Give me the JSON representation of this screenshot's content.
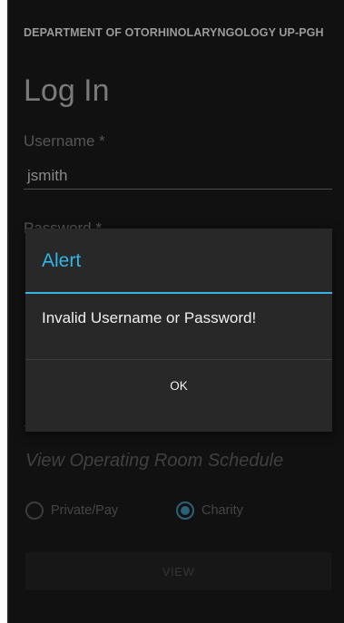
{
  "header": {
    "department": "DEPARTMENT OF OTORHINOLARYNGOLOGY UP-PGH",
    "title": "Log In"
  },
  "form": {
    "username_label": "Username *",
    "username_value": "jsmith",
    "password_label": "Password *"
  },
  "schedule": {
    "heading": "View Operating Room Schedule",
    "options": [
      {
        "label": "Private/Pay",
        "selected": false
      },
      {
        "label": "Charity",
        "selected": true
      }
    ],
    "view_button": "VIEW"
  },
  "dialog": {
    "title": "Alert",
    "message": "Invalid Username or Password!",
    "ok_label": "OK"
  },
  "colors": {
    "accent": "#33b5e5",
    "dialog_bg": "#282828"
  }
}
